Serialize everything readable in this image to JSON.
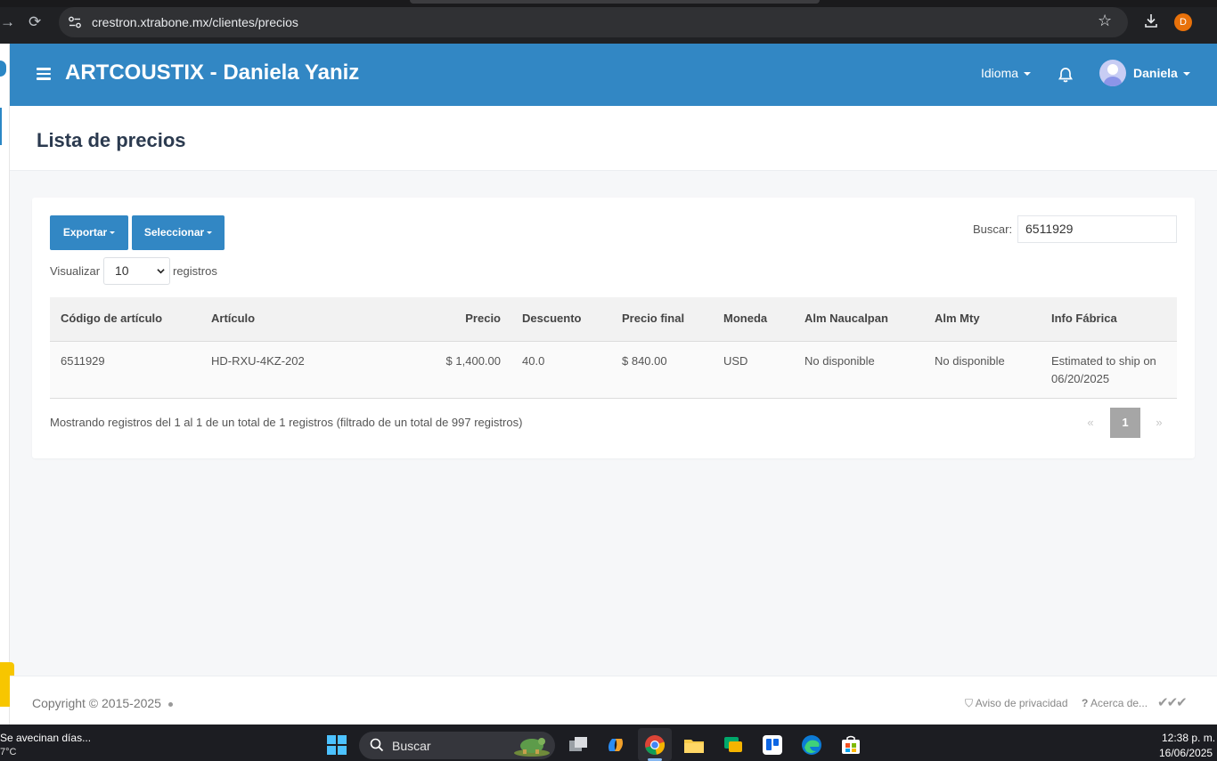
{
  "browser": {
    "url": "crestron.xtrabone.mx/clientes/precios",
    "profile_initial": "D"
  },
  "header": {
    "title": "ARTCOUSTIX - Daniela Yaniz",
    "language_menu": "Idioma",
    "user_name": "Daniela"
  },
  "page": {
    "title": "Lista de precios"
  },
  "toolbar": {
    "export_label": "Exportar",
    "select_label": "Seleccionar",
    "search_label": "Buscar:",
    "search_value": "6511929",
    "show_prefix": "Visualizar",
    "show_value": "10",
    "show_suffix": "registros"
  },
  "table": {
    "columns": [
      "Código de artículo",
      "Artículo",
      "Precio",
      "Descuento",
      "Precio final",
      "Moneda",
      "Alm Naucalpan",
      "Alm Mty",
      "Info Fábrica"
    ],
    "rows": [
      {
        "code": "6511929",
        "article": "HD-RXU-4KZ-202",
        "price": "$ 1,400.00",
        "discount": "40.0",
        "final_price": "$ 840.00",
        "currency": "USD",
        "alm_naucalpan": "No disponible",
        "alm_mty": "No disponible",
        "info_line1": "Estimated to ship on",
        "info_line2": "06/20/2025"
      }
    ]
  },
  "pagination": {
    "info": "Mostrando registros del 1 al 1 de un total de 1 registros (filtrado de un total de 997 registros)",
    "prev": "«",
    "current": "1",
    "next": "»"
  },
  "footer": {
    "copyright": "Copyright © 2015-2025",
    "privacy": "Aviso de privacidad",
    "about": "Acerca de..."
  },
  "taskbar": {
    "weather_title": "Se avecinan días...",
    "weather_temp": "7°C",
    "search_label": "Buscar",
    "time": "12:38 p. m.",
    "date": "16/06/2025"
  },
  "colors": {
    "brand": "#3287c4",
    "pager_active": "#a6a6a6"
  },
  "icons": [
    "back-icon",
    "reload-icon",
    "site-settings-icon",
    "star-icon",
    "download-icon",
    "menu-icon",
    "bell-icon",
    "avatar",
    "shield-icon",
    "question-icon",
    "windows-icon",
    "search-icon"
  ]
}
